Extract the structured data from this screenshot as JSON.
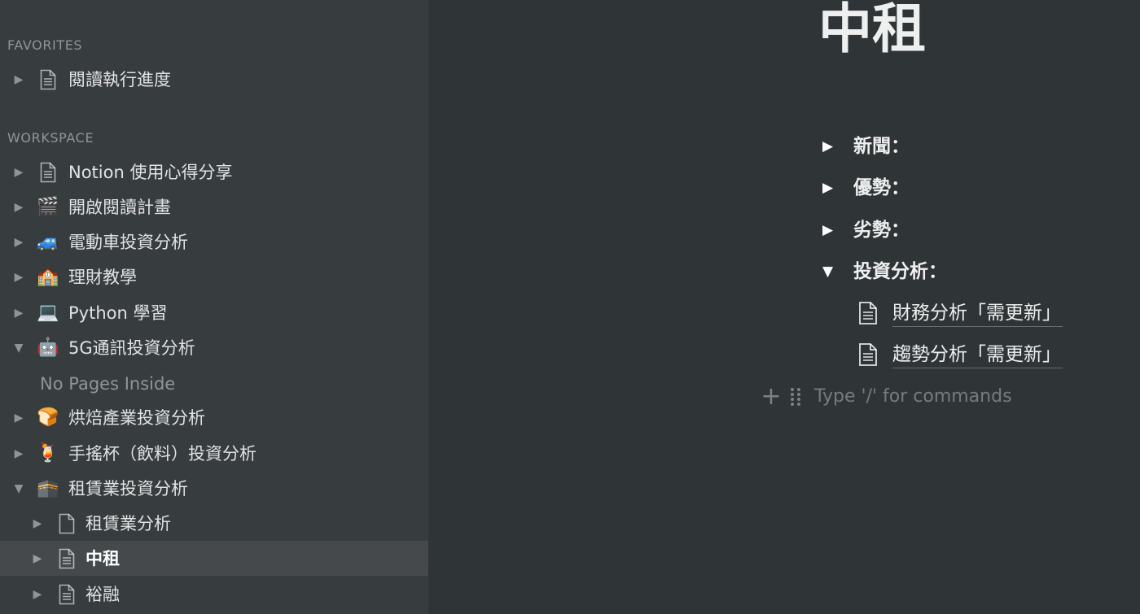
{
  "sidebar": {
    "favorites_label": "FAVORITES",
    "workspace_label": "WORKSPACE",
    "favorites": [
      {
        "label": "閱讀執行進度",
        "icon": "page-icon",
        "expanded": false
      }
    ],
    "workspace": [
      {
        "label": "Notion 使用心得分享",
        "icon": "page-icon",
        "emoji": "",
        "expanded": false
      },
      {
        "label": "開啟閱讀計畫",
        "icon": "clapper-board-icon",
        "emoji": "🎬",
        "expanded": false
      },
      {
        "label": "電動車投資分析",
        "icon": "car-icon",
        "emoji": "🚙",
        "expanded": false
      },
      {
        "label": "理財教學",
        "icon": "school-icon",
        "emoji": "🏫",
        "expanded": false
      },
      {
        "label": "Python 學習",
        "icon": "laptop-icon",
        "emoji": "💻",
        "expanded": false
      },
      {
        "label": "5G通訊投資分析",
        "icon": "robot-icon",
        "emoji": "🤖",
        "expanded": true
      },
      {
        "label": "烘焙產業投資分析",
        "icon": "bread-icon",
        "emoji": "🍞",
        "expanded": false
      },
      {
        "label": "手搖杯（飲料）投資分析",
        "icon": "tropical-drink-icon",
        "emoji": "🍹",
        "expanded": false
      },
      {
        "label": "租賃業投資分析",
        "icon": "kaaba-icon",
        "emoji": "🕋",
        "expanded": true
      }
    ],
    "empty_note": "No Pages Inside",
    "children": [
      {
        "label": "租賃業分析",
        "icon": "empty-page-icon",
        "selected": false
      },
      {
        "label": "中租",
        "icon": "page-icon",
        "selected": true
      },
      {
        "label": "裕融",
        "icon": "page-icon",
        "selected": false
      }
    ]
  },
  "main": {
    "title": "中租",
    "toggles": [
      {
        "label": "新聞：",
        "expanded": false
      },
      {
        "label": "優勢：",
        "expanded": false
      },
      {
        "label": "劣勢：",
        "expanded": false
      },
      {
        "label": "投資分析：",
        "expanded": true
      }
    ],
    "subpages": [
      {
        "label": "財務分析「需更新」",
        "icon": "page-icon"
      },
      {
        "label": "趨勢分析「需更新」",
        "icon": "page-icon"
      }
    ],
    "command_placeholder": "Type '/' for commands"
  },
  "colors": {
    "sidebar_bg": "#373c3f",
    "main_bg": "#2f3437",
    "selected_bg": "#45494c"
  }
}
